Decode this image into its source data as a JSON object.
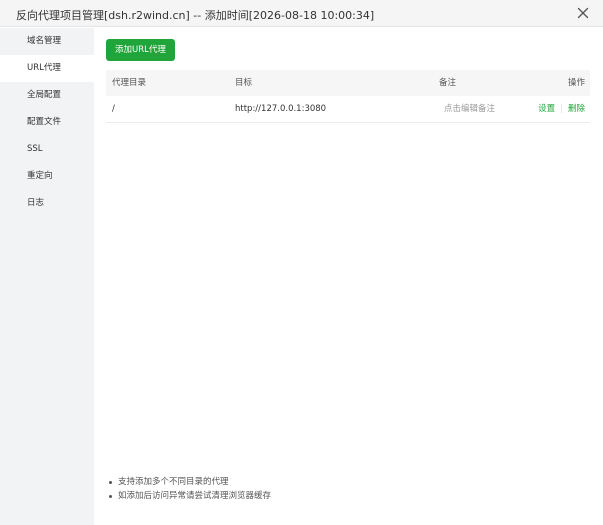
{
  "window": {
    "title": "反向代理项目管理[dsh.r2wind.cn] -- 添加时间[2026-08-18 10:00:34]",
    "close_icon": "close-icon"
  },
  "sidebar": {
    "items": [
      {
        "label": "域名管理",
        "active": false
      },
      {
        "label": "URL代理",
        "active": true
      },
      {
        "label": "全局配置",
        "active": false
      },
      {
        "label": "配置文件",
        "active": false
      },
      {
        "label": "SSL",
        "active": false
      },
      {
        "label": "重定向",
        "active": false
      },
      {
        "label": "日志",
        "active": false
      }
    ]
  },
  "main": {
    "add_button": "添加URL代理",
    "table": {
      "headers": {
        "dir": "代理目录",
        "target": "目标",
        "note": "备注",
        "ops": "操作"
      },
      "rows": [
        {
          "dir": "/",
          "target": "http://127.0.0.1:3080",
          "note": "点击编辑备注",
          "ops": {
            "settings": "设置",
            "delete": "删除"
          }
        }
      ]
    },
    "tips": [
      "支持添加多个不同目录的代理",
      "如添加后访问异常请尝试清理浏览器缓存"
    ]
  },
  "colors": {
    "accent": "#20a53a",
    "sidebar_bg": "#f2f3f5"
  }
}
